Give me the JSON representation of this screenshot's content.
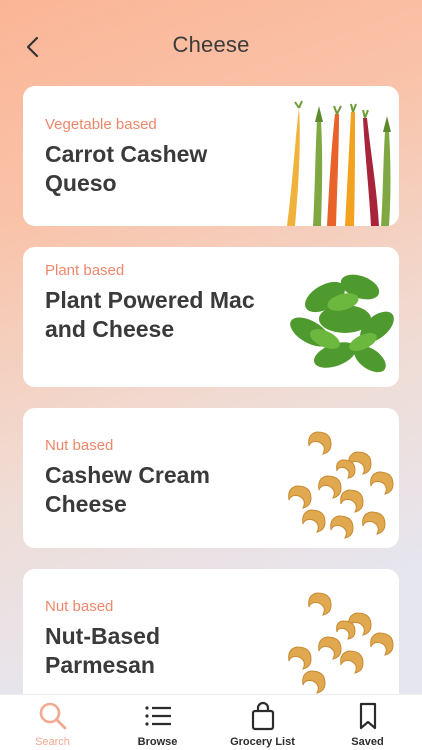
{
  "header": {
    "title": "Cheese"
  },
  "recipes": [
    {
      "tag": "Vegetable based",
      "name": "Carrot Cashew Queso",
      "image": "carrots-asparagus-image"
    },
    {
      "tag": "Plant based",
      "name": "Plant Powered Mac and Cheese",
      "image": "arugula-image"
    },
    {
      "tag": "Nut based",
      "name": "Cashew Cream Cheese",
      "image": "cashews-image"
    },
    {
      "tag": "Nut based",
      "name": "Nut-Based Parmesan",
      "image": "cashews-image"
    }
  ],
  "tabs": [
    {
      "label": "Search",
      "icon": "search-icon",
      "active": true
    },
    {
      "label": "Browse",
      "icon": "list-icon",
      "active": false
    },
    {
      "label": "Grocery List",
      "icon": "shopping-bag-icon",
      "active": false
    },
    {
      "label": "Saved",
      "icon": "bookmark-icon",
      "active": false
    }
  ],
  "colors": {
    "accent": "#ee876a",
    "tab_active": "#f3a891",
    "text": "#3a3a3a"
  }
}
